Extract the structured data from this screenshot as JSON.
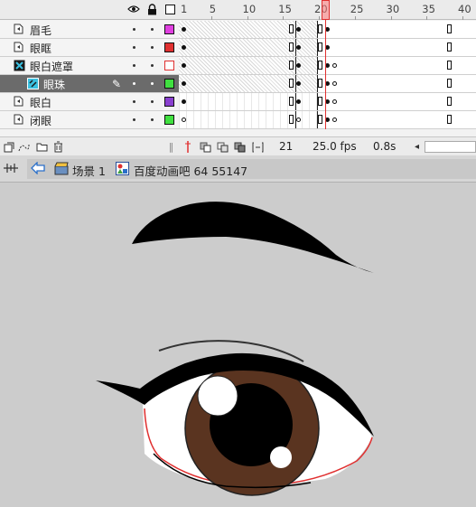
{
  "timeline": {
    "ruler_labels": [
      "1",
      "5",
      "10",
      "15",
      "20",
      "25",
      "30",
      "35",
      "40"
    ],
    "current_frame": 21,
    "layers": [
      {
        "name": "眉毛",
        "type": "normal",
        "color": "#e040e0",
        "color_style": "filled",
        "selected": false
      },
      {
        "name": "眼眶",
        "type": "normal",
        "color": "#e03030",
        "color_style": "filled",
        "selected": false
      },
      {
        "name": "眼白遮罩",
        "type": "mask",
        "color": "#e03030",
        "color_style": "outline",
        "selected": false
      },
      {
        "name": "眼珠",
        "type": "masked",
        "color": "#40e040",
        "color_style": "filled",
        "selected": true
      },
      {
        "name": "眼白",
        "type": "normal",
        "color": "#8a40d0",
        "color_style": "filled",
        "selected": false
      },
      {
        "name": "闭眼",
        "type": "normal",
        "color": "#40e040",
        "color_style": "filled",
        "selected": false
      }
    ],
    "footer": {
      "frame": "21",
      "fps": "25.0 fps",
      "time": "0.8s"
    }
  },
  "editbar": {
    "scene_label": "场景 1",
    "symbol_label": "百度动画吧  64  55147"
  },
  "colors": {
    "stage_bg": "#cccccc",
    "iris": "#5a3420",
    "pupil": "#000000",
    "highlight": "#ffffff",
    "eye_outline_red": "#e03030"
  }
}
